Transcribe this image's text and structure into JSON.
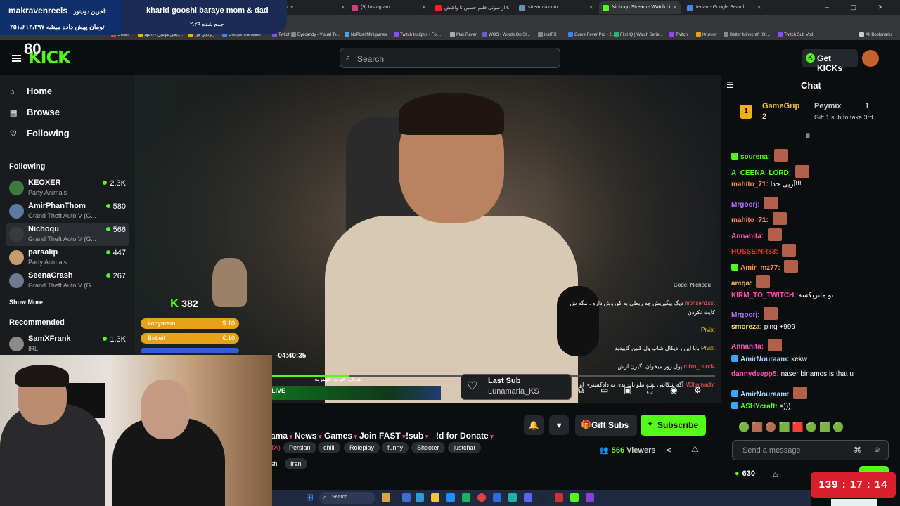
{
  "browser": {
    "tabs": [
      {
        "label": "...m.tv",
        "color": "#5a6b7d"
      },
      {
        "label": "(9) Instagram",
        "color": "#d4407e"
      },
      {
        "label": "از سوتی فلیم حسین تا واکنش...",
        "color": "#ff2020"
      },
      {
        "label": "streamfa.com",
        "color": "#6b8fb3"
      },
      {
        "label": "Nichoqu Stream - Watch Li...",
        "color": "#53fc18"
      },
      {
        "label": "terian - Google Search",
        "color": "#4285f4"
      }
    ],
    "bookmarks": [
      "Gmail",
      "دیجی موبایل - دانلود...",
      "زیرنویل من",
      "Google Translate",
      "Twitch",
      "Eyecandy - Visual Te...",
      "NoPixel Minigames",
      "Twitch Insights - Fol...",
      "Mak Raven",
      "WOS - Words On St...",
      "instRX",
      "Curve Fever Pro - 2...",
      "FlixHQ | Watch Serie...",
      "Twitch",
      "Krunker",
      "Better Minecraft [Of...",
      "Twitch Sub Vod",
      "All Bookmarks"
    ]
  },
  "overlay": {
    "donor_name": "makravenreels",
    "donor_line2": "آخرین دونیتور:",
    "donor_line3": "۲۵۱،۶۱۲،۳۹۷ تومان پهش داده میشه",
    "goal_title": "kharid gooshi baraye mom & dad",
    "goal_sub": "۲.۲۹ جمع شده"
  },
  "header": {
    "logo": "KICK",
    "logo_overlay": "80",
    "search_placeholder": "Search",
    "get_kicks": "Get KICKs"
  },
  "sidebar": {
    "nav": [
      {
        "label": "Home",
        "icon": "home-icon"
      },
      {
        "label": "Browse",
        "icon": "browse-icon"
      },
      {
        "label": "Following",
        "icon": "heart-icon"
      }
    ],
    "following_title": "Following",
    "following": [
      {
        "name": "KEOXER",
        "game": "Party Animals",
        "viewers": "2.3K",
        "color": "#3e7a3e"
      },
      {
        "name": "AmirPhanThom",
        "game": "Grand Theft Auto V (G...",
        "viewers": "580",
        "color": "#5a7aa0"
      },
      {
        "name": "Nichoqu",
        "game": "Grand Theft Auto V (G...",
        "viewers": "566",
        "color": "#3a3a3a"
      },
      {
        "name": "parsalip",
        "game": "Party Animals",
        "viewers": "447",
        "color": "#c69b6d"
      },
      {
        "name": "SeenaCrash",
        "game": "Grand Theft Auto V (G...",
        "viewers": "267",
        "color": "#6c7b8d"
      }
    ],
    "show_more": "Show More",
    "recommended_title": "Recommended",
    "recommended": [
      {
        "name": "SamXFrank",
        "game": "IRL",
        "viewers": "1.3K",
        "color": "#8a8a8a"
      }
    ]
  },
  "video": {
    "kick_count": "382",
    "donations": [
      {
        "name": "kohyaram",
        "amount": "$.10",
        "color": "#e6a31a"
      },
      {
        "name": "Birkeit",
        "amount": "€.10",
        "color": "#e6a31a"
      },
      {
        "name": "",
        "amount": "",
        "color": "#2f5fd0"
      }
    ],
    "time": "-04:40:35",
    "goal_label": "هدف خرید جهیزیه",
    "live": "LIVE",
    "last_sub_title": "Last Sub",
    "last_sub_name": "Lunamaria_KS",
    "code": "Code: Nichoqu",
    "chat_overlay": [
      {
        "user": "mohsen1ss:",
        "text": "دیگ پیگیریش چه ربطی به کوروش داره ، مگه ش"
      },
      {
        "user": "",
        "text": "کایت نکردن"
      },
      {
        "user": "Prvix:",
        "text": ""
      },
      {
        "user": "Prvix:",
        "text": "بابا این رادیکال شاپ ول کنین گاییدید"
      },
      {
        "user": "robin_hood4",
        "text": "پول زور میخوان بگیرن ازش"
      },
      {
        "user": "M0hamadhr",
        "text": "آگه شکایتی بشه بیلو باید بدی به دادگستری او"
      }
    ]
  },
  "channel": {
    "categories": [
      "ama",
      "News",
      "Games",
      "Join FAST",
      "!sub",
      "!d for Donate"
    ],
    "tags_row1": [
      "TA)",
      "Persian",
      "chill",
      "Roleplay",
      "funny",
      "Shooter",
      "justchat"
    ],
    "tags_row2": [
      "sh",
      "Iran"
    ],
    "gift_subs": "Gift Subs",
    "subscribe": "Subscribe",
    "viewers_count": "566",
    "viewers_label": "Viewers"
  },
  "chat": {
    "title": "Chat",
    "pinned": {
      "user1": "GameGrip",
      "user1_count": "2",
      "user1_rank": "1",
      "user2": "Peymix",
      "user2_count": "1",
      "gift_note": "Gift 1 sub to take 3rd"
    },
    "messages": [
      {
        "user": "sourena:",
        "color": "#53fc18",
        "text": "",
        "emote": true,
        "badge": "#53fc18"
      },
      {
        "user": "A_CEENA_LORD:",
        "color": "#53fc18",
        "text": "",
        "emote": true,
        "badge": ""
      },
      {
        "user": "mahito_71:",
        "color": "#ff8c4b",
        "text": "آرپی خدا!!!",
        "emote": false,
        "badge": ""
      },
      {
        "user": "Mrgoorj:",
        "color": "#b774ff",
        "text": "",
        "emote": true,
        "badge": ""
      },
      {
        "user": "mahito_71:",
        "color": "#ff8c4b",
        "text": "",
        "emote": true,
        "badge": ""
      },
      {
        "user": "Annahita:",
        "color": "#ff4fb8",
        "text": "",
        "emote": true,
        "badge": ""
      },
      {
        "user": "HOSSEINR53:",
        "color": "#ff2d2d",
        "text": "",
        "emote": true,
        "badge": ""
      },
      {
        "user": "Amir_mz77:",
        "color": "#ff8c4b",
        "text": "",
        "emote": true,
        "badge": "#53fc18"
      },
      {
        "user": "amqa:",
        "color": "#ffb347",
        "text": "",
        "emote": true,
        "badge": ""
      },
      {
        "user": "KIRM_TO_TWITCH:",
        "color": "#ff4fb8",
        "text": "تو ماتریکسه",
        "emote": false,
        "badge": ""
      },
      {
        "user": "Mrgoorj:",
        "color": "#b774ff",
        "text": "",
        "emote": true,
        "badge": ""
      },
      {
        "user": "smoreza:",
        "color": "#ffe26b",
        "text": "ping +999",
        "emote": false,
        "badge": ""
      },
      {
        "user": "Annahita:",
        "color": "#ff4fb8",
        "text": "",
        "emote": true,
        "badge": ""
      },
      {
        "user": "AmirNouraam:",
        "color": "#a5d9ff",
        "text": "kekw",
        "emote": false,
        "badge": "#3aa7ff"
      },
      {
        "user": "dannydeepp5:",
        "color": "#ff4fb8",
        "text": "naser binamos is that u",
        "emote": false,
        "badge": ""
      },
      {
        "user": "AmirNouraam:",
        "color": "#a5d9ff",
        "text": "",
        "emote": true,
        "badge": "#3aa7ff"
      },
      {
        "user": "ASHYcraft:",
        "color": "#53fc18",
        "text": "=)))",
        "emote": false,
        "badge": "#3aa7ff"
      }
    ],
    "send_placeholder": "Send a message",
    "points": "630",
    "timer": "139 : 17 : 14"
  },
  "taskbar": {
    "search": "Search"
  }
}
